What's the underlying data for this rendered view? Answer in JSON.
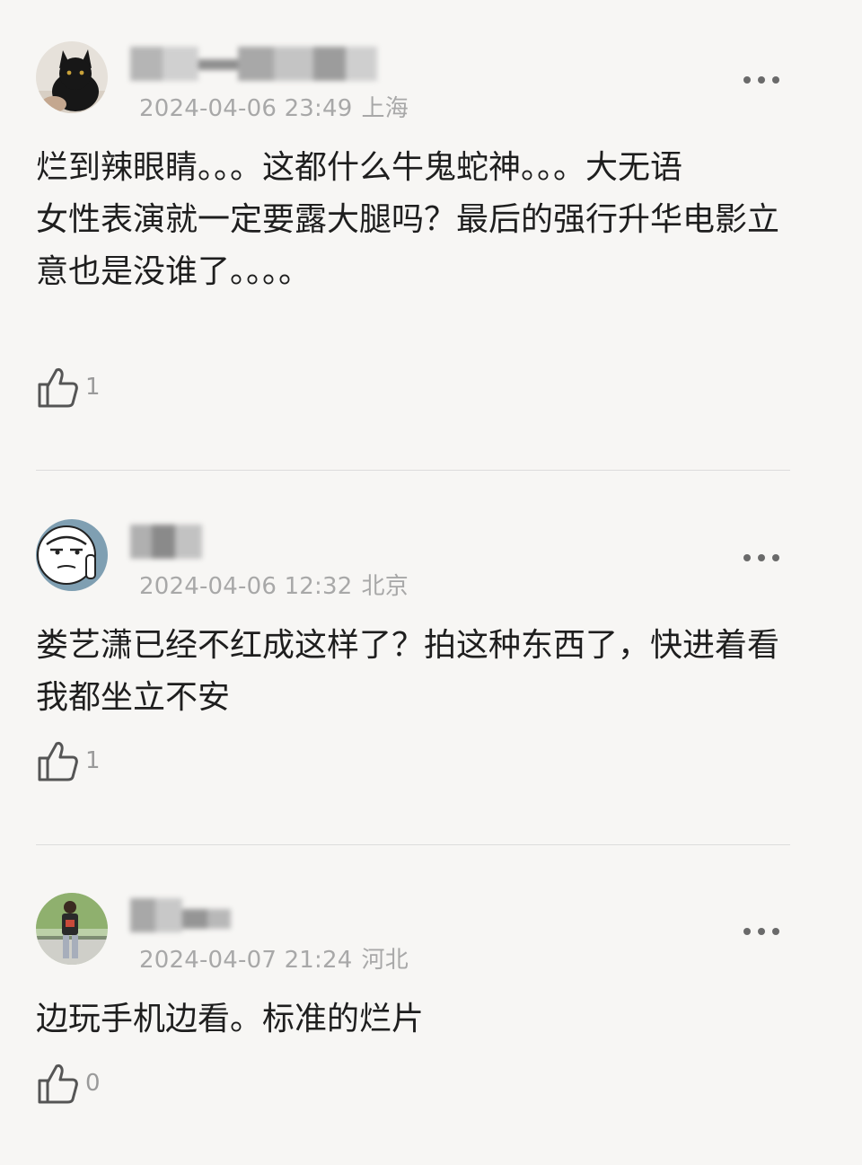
{
  "comments": [
    {
      "avatar_icon": "black-cat-avatar",
      "timestamp": "2024-04-06 23:49",
      "location": "上海",
      "lines": [
        "烂到辣眼睛。。。这都什么牛鬼蛇神。。。大无语",
        "女性表演就一定要露大腿吗？最后的强行升华电影立意也是没谁了。。。。"
      ],
      "likes": "1"
    },
    {
      "avatar_icon": "cartoon-face-avatar",
      "timestamp": "2024-04-06 12:32",
      "location": "北京",
      "lines": [
        "娄艺潇已经不红成这样了？拍这种东西了，快进着看我都坐立不安"
      ],
      "likes": "1"
    },
    {
      "avatar_icon": "person-outdoor-avatar",
      "timestamp": "2024-04-07 21:24",
      "location": "河北",
      "lines": [
        "边玩手机边看。标准的烂片"
      ],
      "likes": "0"
    }
  ],
  "icons": {
    "more": "more-dots-icon",
    "like": "thumbs-up-icon"
  },
  "colors": {
    "background": "#f7f6f4",
    "meta_text": "#a8a8a8",
    "body_text": "#1e1e1e",
    "divider": "#dcdcdc"
  }
}
